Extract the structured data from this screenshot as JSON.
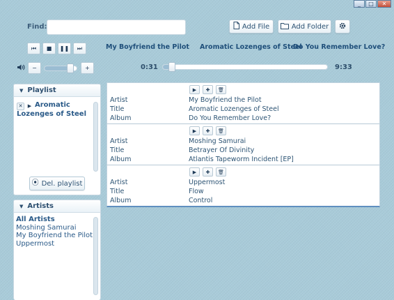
{
  "window": {
    "minimize": "_",
    "maximize": "□",
    "close": "✕"
  },
  "find": {
    "label": "Find:",
    "value": "",
    "placeholder": ""
  },
  "toolbar": {
    "add_file_label": "Add File",
    "add_folder_label": "Add Folder",
    "add_file_icon": "file-icon",
    "add_folder_icon": "folder-icon",
    "settings_icon": "gear-icon"
  },
  "transport": {
    "prev": "⏮",
    "stop": "■",
    "pause": "❚❚",
    "next": "⏭",
    "volume_icon": "speaker-icon",
    "minus": "−",
    "plus": "+",
    "volume_level": 0.8
  },
  "now_playing": {
    "artist": "My Boyfriend the Pilot",
    "title": "Aromatic Lozenges of Steel",
    "album": "Do You Remember Love?"
  },
  "progress": {
    "elapsed": "0:31",
    "total": "9:33",
    "fraction": 0.054
  },
  "playlist": {
    "header": "Playlist",
    "items": [
      {
        "label": "Aromatic Lozenges of Steel"
      }
    ],
    "delete_label": "Del. playlist"
  },
  "artists": {
    "header": "Artists",
    "items": [
      "All Artists",
      "Moshing Samurai",
      "My Boyfriend the Pilot",
      "Uppermost"
    ]
  },
  "track_fields": {
    "artist": "Artist",
    "title": "Title",
    "album": "Album"
  },
  "tracks": [
    {
      "artist": "My Boyfriend the Pilot",
      "title": "Aromatic Lozenges of Steel",
      "album": "Do You Remember Love?"
    },
    {
      "artist": "Moshing Samurai",
      "title": "Betrayer Of Divinity",
      "album": "Atlantis Tapeworm Incident [EP]"
    },
    {
      "artist": "Uppermost",
      "title": "Flow",
      "album": "Control"
    }
  ],
  "colors": {
    "background": "#a9cbd9",
    "accent": "#5f8fc0",
    "text": "#2a5a88"
  }
}
